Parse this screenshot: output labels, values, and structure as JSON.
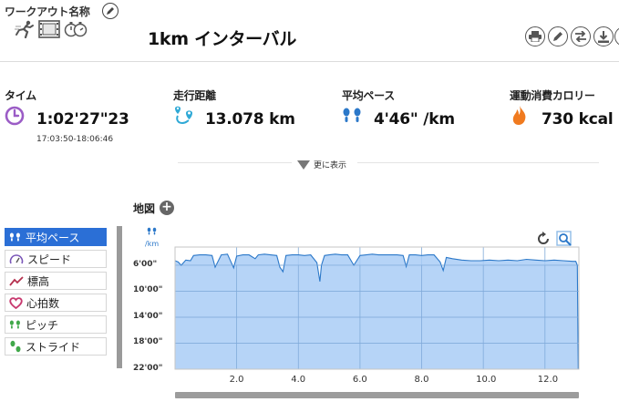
{
  "header": {
    "workout_name_label": "ワークアウト名称",
    "title": "1km インターバル"
  },
  "stats": {
    "time": {
      "label": "タイム",
      "value": "1:02'27\"23",
      "range": "17:03:50-18:06:46"
    },
    "distance": {
      "label": "走行距離",
      "value": "13.078 km"
    },
    "pace": {
      "label": "平均ペース",
      "value": "4'46\" /km"
    },
    "calories": {
      "label": "運動消費カロリー",
      "value": "730 kcal"
    }
  },
  "more": {
    "label": "更に表示"
  },
  "map": {
    "label": "地図"
  },
  "metrics": [
    {
      "label": "平均ペース",
      "icon": "footprints-icon",
      "active": true
    },
    {
      "label": "スピード",
      "icon": "speedometer-icon",
      "active": false
    },
    {
      "label": "標高",
      "icon": "elevation-trend-icon",
      "active": false
    },
    {
      "label": "心拍数",
      "icon": "heart-icon",
      "active": false
    },
    {
      "label": "ピッチ",
      "icon": "footprints-icon",
      "active": false
    },
    {
      "label": "ストライド",
      "icon": "stride-footprints-icon",
      "active": false
    }
  ],
  "chart_data": {
    "type": "area",
    "unit": "/km",
    "y_ticks": [
      "6'00\"",
      "10'00\"",
      "14'00\"",
      "18'00\"",
      "22'00\""
    ],
    "y_tick_minutes": [
      6,
      10,
      14,
      18,
      22
    ],
    "y_inverted": true,
    "x_ticks": [
      "2.0",
      "4.0",
      "6.0",
      "8.0",
      "10.0",
      "12.0"
    ],
    "x_tick_values": [
      2,
      4,
      6,
      8,
      10,
      12
    ],
    "xlim": [
      0,
      13.1
    ],
    "ylim": [
      3.2,
      22
    ],
    "grid": true,
    "series": [
      {
        "color": "#2b78c9",
        "fill": "#a9cdf6",
        "x": [
          0,
          0.1,
          0.2,
          0.35,
          0.5,
          0.6,
          0.8,
          1.0,
          1.2,
          1.3,
          1.5,
          1.7,
          1.9,
          2.0,
          2.2,
          2.4,
          2.6,
          2.7,
          2.9,
          3.1,
          3.3,
          3.4,
          3.5,
          3.6,
          3.8,
          4.0,
          4.2,
          4.4,
          4.6,
          4.7,
          4.75,
          4.85,
          5.0,
          5.2,
          5.4,
          5.6,
          5.8,
          6.0,
          6.2,
          6.4,
          6.6,
          6.8,
          7.0,
          7.2,
          7.4,
          7.5,
          7.6,
          7.8,
          8.0,
          8.2,
          8.4,
          8.6,
          8.7,
          8.8,
          9.0,
          9.3,
          9.6,
          9.9,
          10.2,
          10.5,
          10.8,
          11.1,
          11.4,
          11.7,
          12.0,
          12.3,
          12.6,
          12.9,
          13.0,
          13.05,
          13.078
        ],
        "y_min_per_km": [
          5.3,
          5.5,
          6.0,
          5.2,
          5.3,
          4.5,
          4.4,
          4.4,
          4.5,
          6.3,
          4.4,
          4.3,
          6.4,
          4.6,
          4.4,
          4.4,
          5.0,
          4.4,
          4.3,
          4.4,
          4.5,
          6.3,
          7.0,
          4.5,
          4.4,
          4.4,
          4.5,
          4.4,
          5.6,
          8.5,
          6.0,
          4.5,
          4.4,
          4.3,
          4.4,
          4.4,
          6.0,
          4.5,
          4.4,
          4.3,
          4.4,
          4.4,
          4.4,
          4.4,
          4.5,
          6.2,
          4.4,
          4.4,
          4.5,
          4.4,
          4.4,
          5.5,
          6.8,
          4.8,
          5.0,
          5.2,
          5.3,
          5.3,
          5.2,
          5.3,
          5.2,
          5.3,
          5.1,
          5.2,
          5.3,
          5.2,
          5.3,
          5.4,
          5.4,
          6.0,
          22
        ]
      }
    ]
  }
}
